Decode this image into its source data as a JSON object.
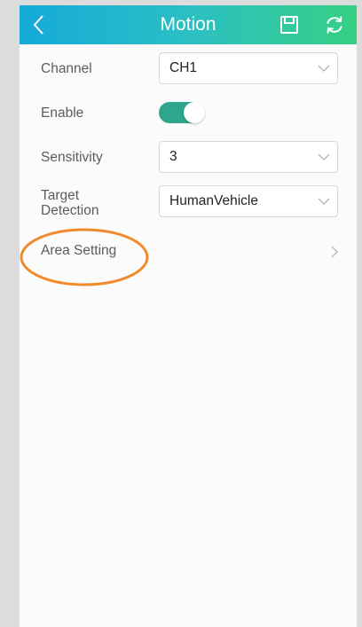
{
  "header": {
    "title": "Motion",
    "back_icon": "chevron-left-icon",
    "save_icon": "save-icon",
    "refresh_icon": "refresh-icon",
    "gradient_colors": [
      "#15aad8",
      "#36d083"
    ]
  },
  "form": {
    "channel": {
      "label": "Channel",
      "value": "CH1"
    },
    "enable": {
      "label": "Enable",
      "on": true,
      "color": "#2ea58d"
    },
    "sensitivity": {
      "label": "Sensitivity",
      "value": "3"
    },
    "target_detection": {
      "label_line1": "Target",
      "label_line2": "Detection",
      "value": "HumanVehicle"
    },
    "area_setting": {
      "label": "Area Setting"
    }
  },
  "annotation": {
    "color": "#f08a2c"
  }
}
